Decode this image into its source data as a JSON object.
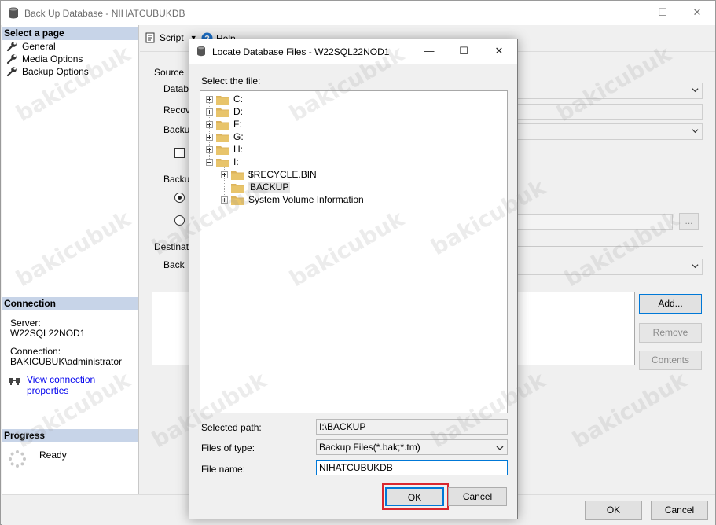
{
  "window": {
    "title": "Back Up Database - NIHATCUBUKDB",
    "minimize": "—",
    "maximize": "☐",
    "close": "✕"
  },
  "left_pane": {
    "select_page_header": "Select a page",
    "pages": [
      {
        "label": "General",
        "icon": "wrench-icon"
      },
      {
        "label": "Media Options",
        "icon": "wrench-icon"
      },
      {
        "label": "Backup Options",
        "icon": "wrench-icon"
      }
    ],
    "connection_header": "Connection",
    "server_label": "Server:",
    "server_value": "W22SQL22NOD1",
    "connection_label": "Connection:",
    "connection_value": "BAKICUBUK\\administrator",
    "view_connection_link": "View connection properties",
    "progress_header": "Progress",
    "progress_status": "Ready"
  },
  "toolbar": {
    "script_label": "Script",
    "help_label": "Help"
  },
  "general_page": {
    "source_label": "Source",
    "database_label": "Databa",
    "recovery_label": "Recov",
    "backup_type_label": "Backup",
    "backup_component_label": "Backu",
    "destination_label": "Destinati",
    "back_up_to_label": "Back",
    "add_button": "Add...",
    "remove_button": "Remove",
    "contents_button": "Contents",
    "browse_button": "..."
  },
  "footer": {
    "ok_label": "OK",
    "cancel_label": "Cancel"
  },
  "dialog": {
    "title": "Locate Database Files - W22SQL22NOD1",
    "select_file_label": "Select the file:",
    "tree": [
      {
        "label": "C:",
        "level": 0,
        "expander": "plus"
      },
      {
        "label": "D:",
        "level": 0,
        "expander": "plus"
      },
      {
        "label": "F:",
        "level": 0,
        "expander": "plus"
      },
      {
        "label": "G:",
        "level": 0,
        "expander": "plus"
      },
      {
        "label": "H:",
        "level": 0,
        "expander": "plus"
      },
      {
        "label": "I:",
        "level": 0,
        "expander": "minus"
      },
      {
        "label": "$RECYCLE.BIN",
        "level": 1,
        "expander": "plus"
      },
      {
        "label": "BACKUP",
        "level": 1,
        "expander": "none",
        "selected": true
      },
      {
        "label": "System Volume Information",
        "level": 1,
        "expander": "plus"
      }
    ],
    "selected_path_label": "Selected path:",
    "selected_path_value": "I:\\BACKUP",
    "files_of_type_label": "Files of type:",
    "files_of_type_value": "Backup Files(*.bak;*.tm)",
    "file_name_label": "File name:",
    "file_name_value": "NIHATCUBUKDB",
    "ok_label": "OK",
    "cancel_label": "Cancel"
  },
  "watermark": "bakicubuk",
  "colors": {
    "pane_header_bg": "#c7d4e8",
    "link": "#0000ee",
    "focus_border": "#0078d7",
    "highlight_red": "#d9272e",
    "folder": "#dcb35c"
  }
}
